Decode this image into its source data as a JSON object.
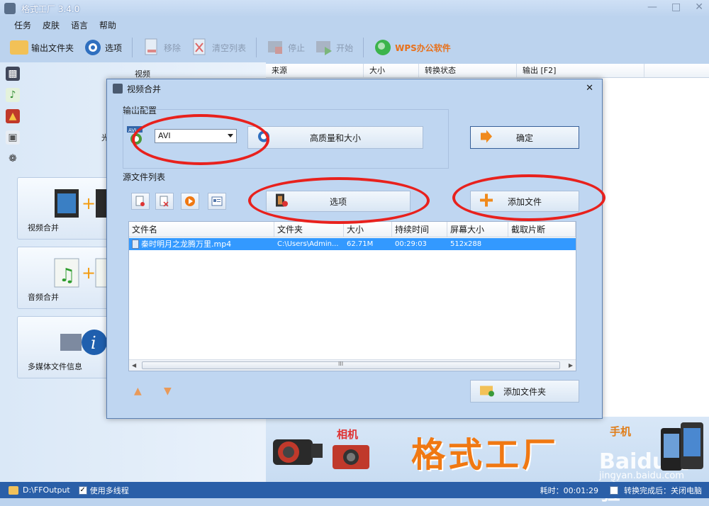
{
  "window": {
    "title": "格式工厂 3.4.0"
  },
  "menu": [
    "任务",
    "皮肤",
    "语言",
    "帮助"
  ],
  "toolbar": {
    "output_folder": "输出文件夹",
    "options": "选项",
    "remove": "移除",
    "clear_list": "清空列表",
    "stop": "停止",
    "start": "开始",
    "wps": "WPS办公软件"
  },
  "left_panel": {
    "section_video": "视频",
    "section_stub": "光",
    "cards": [
      "视频合并",
      "音频合并",
      "多媒体文件信息"
    ]
  },
  "task_list": {
    "columns": [
      "来源",
      "大小",
      "转换状态",
      "输出 [F2]"
    ]
  },
  "dialog": {
    "title": "视频合并",
    "output_config_label": "输出配置",
    "format_value": "AVI",
    "avi_badge": "AVI",
    "quality_button": "高质量和大小",
    "ok_button": "确定",
    "source_list_label": "源文件列表",
    "options_button": "选项",
    "add_file_button": "添加文件",
    "add_folder_button": "添加文件夹",
    "file_table": {
      "columns": [
        "文件名",
        "文件夹",
        "大小",
        "持续时间",
        "屏幕大小",
        "截取片断"
      ],
      "rows": [
        {
          "name": "秦时明月之龙腾万里.mp4",
          "folder": "C:\\Users\\Admin...",
          "size": "62.71M",
          "duration": "00:29:03",
          "screen": "512x288",
          "clip": ""
        }
      ]
    },
    "scroll_grip": "III"
  },
  "banner": {
    "camera_label": "相机",
    "brand": "格式工厂",
    "phone_label": "手机",
    "watermark": "Baidu经验",
    "watermark_url": "jingyan.baidu.com"
  },
  "statusbar": {
    "output_path": "D:\\FFOutput",
    "multithread": "使用多线程",
    "elapsed": "耗时：00:01:29",
    "after_convert": "转换完成后：关闭电脑"
  },
  "colors": {
    "accent": "#2a5fa8",
    "highlight": "#3399ff",
    "annotation": "#e8211d",
    "brand": "#f07812"
  }
}
